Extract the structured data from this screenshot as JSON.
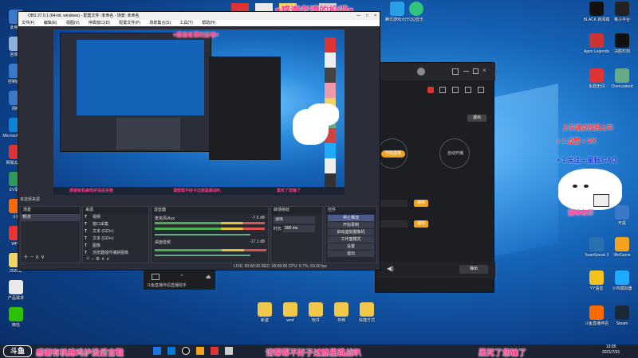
{
  "desktop_left": [
    "此电脑",
    "回收站",
    "控制面板",
    "网络",
    "Microsoft Edge",
    "网易云音乐",
    "EV录屏",
    "斗鱼",
    "WPS",
    "2020年",
    "产品需求",
    "微信"
  ],
  "desktop_left_icons": [
    "computer-icon",
    "recycle-bin-icon",
    "control-panel-icon",
    "network-icon",
    "edge-icon",
    "music-icon",
    "recorder-icon",
    "douyu-icon",
    "wps-icon",
    "folder-icon",
    "document-icon",
    "wechat-icon"
  ],
  "desktop_right": [
    "BLACK 新闻端",
    "格斗平台",
    "Apex Legends",
    "决胜时刻",
    "永劫无间",
    "Overcooked",
    "开黑",
    "TeamSpeak 3",
    "WeGame",
    "YY语音",
    "小鸡模拟器",
    "斗鱼直播伴侣",
    "Steam"
  ],
  "desktop_bottom": [
    "新建",
    "wmf",
    "软件",
    "存档",
    "快捷方式"
  ],
  "top_icons": [
    "",
    "",
    "",
    "",
    "腾讯游戏大厅",
    "QQ音乐"
  ],
  "obs": {
    "title": "OBS 27.0.1 (64-bit, windows) - 配置文件: 未命名 - 场景: 未命名",
    "menu": [
      "文件(F)",
      "编辑(E)",
      "视图(V)",
      "停靠窗口(D)",
      "配置文件(P)",
      "场景集合(S)",
      "工具(T)",
      "帮助(H)"
    ],
    "scenes_header": "场景",
    "sources_header": "来源",
    "scene_item": "场景",
    "sources": [
      "视频",
      "窗口采集",
      "文本 (GDI+)",
      "文本 (GDI+)",
      "图像",
      "浏览器插件捕获图像"
    ],
    "mixer_header": "混音器",
    "mixer_tracks": [
      {
        "name": "麦克风/Aux",
        "db": "-7.6 dB"
      },
      {
        "name": "桌面音频",
        "db": "-17.1 dB"
      }
    ],
    "transitions_header": "转场特效",
    "transition_type": "淡出",
    "duration_label": "时长",
    "duration_value": "300 ms",
    "controls_header": "控件",
    "controls": [
      "停止推流",
      "开始录制",
      "启动虚拟摄像机",
      "工作室模式",
      "设置",
      "退出"
    ],
    "status": "LIVE: 00:00:00   REC: 00:00:00   CPU: 5.7%, 60.00 fps",
    "status_left": "未选择来源"
  },
  "banners": {
    "top": "♥感谢老谭的投喂♥",
    "bottom_left": "感谢有机蜂鸡护没后言鞋",
    "bottom_mid": "请帮帮不好子过掳星跳战叭",
    "bottom_right": "黑死了您输了",
    "preview_mid": "请帮帮不好子过掳星跳战叭",
    "preview_left": "感谢有机蜂鸡护没后言鞋",
    "preview_right": "黑死了您输了"
  },
  "stickers": {
    "line1": "上车请点找我上车",
    "line2": "× 1  点赞 + VX",
    "line3": "× 1  关注 + 星标 GAQ",
    "cat_label": "猫咪老师"
  },
  "app2": {
    "circle1": "开始直播",
    "circle2": "自动开播",
    "row1_btn": "编辑",
    "row2_btn": "编辑",
    "bottom_btn": "弹出",
    "right_btn": "退出"
  },
  "taskbar": {
    "logo": "斗鱼",
    "time": "13:05",
    "date": "2021/7/31"
  },
  "inner_taskbar": "斗鱼直播伴侣直播助手"
}
